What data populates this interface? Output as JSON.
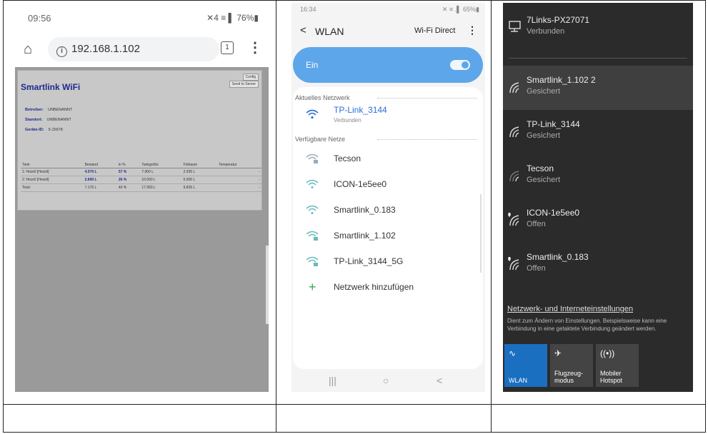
{
  "panel1": {
    "status_time": "09:56",
    "status_icons": "✕4 ≡ ▌ 76%▮",
    "url": "192.168.1.102",
    "tab_count": "1",
    "page": {
      "title": "Smartlink WiFi",
      "config_button": "Config",
      "send_button": "Send to Server",
      "fields": [
        {
          "label": "Betreiber:",
          "value": "UNBENANNT"
        },
        {
          "label": "Standort:",
          "value": "UNBENANNT"
        },
        {
          "label": "Geräte-ID:",
          "value": "5-15678"
        }
      ],
      "table": {
        "headers": [
          "Tank",
          "Bestand",
          "in %",
          "Tankgröße",
          "Füllraum",
          "Temperatur"
        ],
        "rows": [
          [
            "1: Heizöl [Heizöl]",
            "4.570 L",
            "57 %",
            "7.900 L",
            "2.935 L",
            "-"
          ],
          [
            "2: Heizöl [Heizöl]",
            "2.600 L",
            "26 %",
            "10.000 L",
            "6.900 L",
            "-"
          ],
          [
            "Total:",
            "7.170 L",
            "40 %",
            "17.900 L",
            "9.835 L",
            "-"
          ]
        ]
      }
    }
  },
  "panel2": {
    "status_time": "16:34",
    "status_icons": "✕ ≡ .▌ 65%▮",
    "title": "WLAN",
    "wifi_direct": "Wi-Fi Direct",
    "toggle_label": "Ein",
    "current_section": "Aktuelles Netzwerk",
    "current": {
      "name": "TP-Link_3144",
      "status": "Verbunden"
    },
    "available_section": "Verfügbare Netze",
    "networks": [
      "Tecson",
      "ICON-1e5ee0",
      "Smartlink_0.183",
      "Smartlink_1.102",
      "TP-Link_3144_5G"
    ],
    "add_network": "Netzwerk hinzufügen",
    "nav": {
      "recent": "|||",
      "home": "○",
      "back": "<"
    }
  },
  "panel3": {
    "rows": [
      {
        "name": "7Links-PX27071",
        "status": "Verbunden",
        "type": "ethernet"
      },
      {
        "name": "Smartlink_1.102 2",
        "status": "Gesichert",
        "type": "secured"
      },
      {
        "name": "TP-Link_3144",
        "status": "Gesichert",
        "type": "secured"
      },
      {
        "name": "Tecson",
        "status": "Gesichert",
        "type": "secured"
      },
      {
        "name": "ICON-1e5ee0",
        "status": "Offen",
        "type": "open"
      },
      {
        "name": "Smartlink_0.183",
        "status": "Offen",
        "type": "open"
      }
    ],
    "settings_link": "Netzwerk- und Interneteinstellungen",
    "settings_desc": "Dient zum Ändern von Einstellungen. Beispielsweise kann eine Verbindung in eine getaktete Verbindung geändert werden.",
    "tiles": [
      {
        "label": "WLAN",
        "label2": ""
      },
      {
        "label": "Flugzeug-",
        "label2": "modus"
      },
      {
        "label": "Mobiler",
        "label2": "Hotspot"
      }
    ]
  }
}
